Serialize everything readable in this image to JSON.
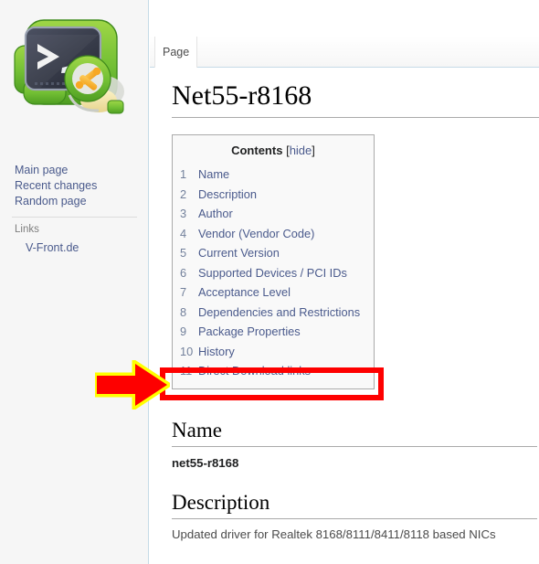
{
  "sidebar": {
    "logo": {
      "icon": "terminal-tools-logo",
      "colors": {
        "green": "#7ac943",
        "green_dark": "#4f9e22",
        "screen": "#3b3f4d",
        "screen_dark": "#2b2e3a",
        "prompt": "#f2f2f2",
        "orange": "#f7a823",
        "cream": "#f2e3a8"
      }
    },
    "nav_items": [
      {
        "label": "Main page"
      },
      {
        "label": "Recent changes"
      },
      {
        "label": "Random page"
      }
    ],
    "portlets": [
      {
        "heading": "Links",
        "items": [
          {
            "label": "V-Front.de"
          }
        ]
      }
    ]
  },
  "content": {
    "tabs": [
      {
        "label": "Page",
        "active": true
      }
    ],
    "title": "Net55-r8168",
    "toc": {
      "heading": "Contents",
      "bracket_open": "[",
      "hide_label": "hide",
      "bracket_close": "]",
      "entries": [
        {
          "num": "1",
          "label": "Name"
        },
        {
          "num": "2",
          "label": "Description"
        },
        {
          "num": "3",
          "label": "Author"
        },
        {
          "num": "4",
          "label": "Vendor (Vendor Code)"
        },
        {
          "num": "5",
          "label": "Current Version"
        },
        {
          "num": "6",
          "label": "Supported Devices / PCI IDs"
        },
        {
          "num": "7",
          "label": "Acceptance Level"
        },
        {
          "num": "8",
          "label": "Dependencies and Restrictions"
        },
        {
          "num": "9",
          "label": "Package Properties"
        },
        {
          "num": "10",
          "label": "History"
        },
        {
          "num": "11",
          "label": "Direct Download links"
        }
      ]
    },
    "sections": [
      {
        "heading": "Name",
        "body": "net55-r8168"
      },
      {
        "heading": "Description",
        "body": "Updated driver for Realtek 8168/8111/8411/8118 based NICs"
      }
    ]
  },
  "annotations": {
    "highlight_box": {
      "target": "toc-entry-11-direct-download-links",
      "color": "#fe0000"
    },
    "arrow": {
      "direction": "right",
      "fill": "#fe0000",
      "outline": "#ffff00"
    }
  },
  "colors": {
    "sidebar_bg": "#f6f6f6",
    "content_bg": "#ffffff",
    "link": "#4a5a8c",
    "rule": "#aaaaaa",
    "tab_border": "#c6dbe7",
    "annotation_red": "#fe0000",
    "annotation_yellow": "#ffff00"
  }
}
